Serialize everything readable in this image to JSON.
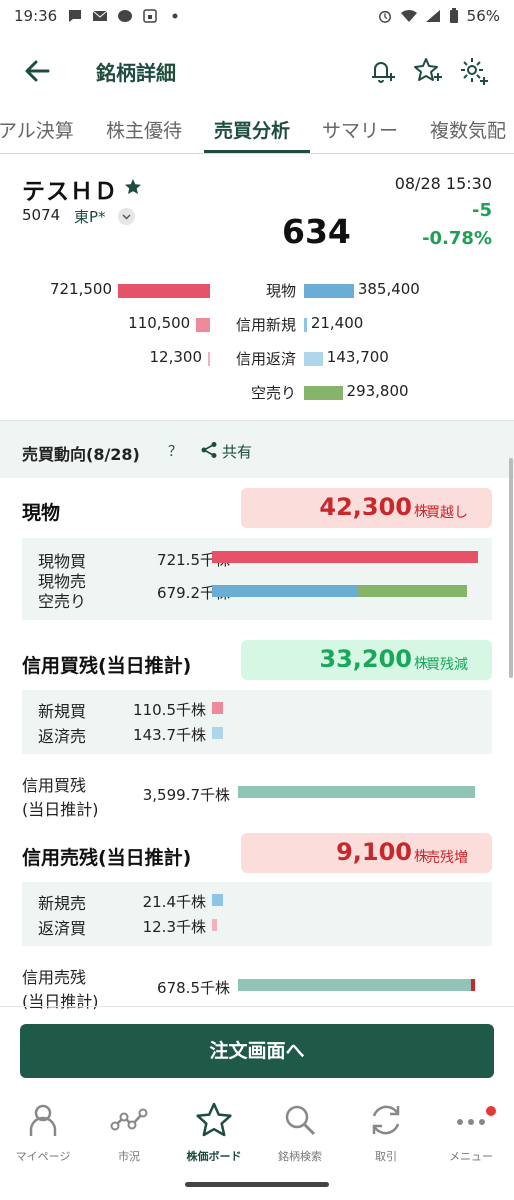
{
  "status_bar": {
    "time": "19:36",
    "battery": "56%"
  },
  "header": {
    "title": "銘柄詳細"
  },
  "tabs": [
    {
      "label": "アル決算"
    },
    {
      "label": "株主優待"
    },
    {
      "label": "売買分析"
    },
    {
      "label": "サマリー"
    },
    {
      "label": "複数気配"
    }
  ],
  "stock": {
    "name": "テスＨＤ",
    "code": "5074",
    "market": "東P*",
    "price": "634",
    "datetime": "08/28 15:30",
    "change": "-5",
    "change_pct": "-0.78%"
  },
  "summary": [
    {
      "left_value": "721,500",
      "left_fraction": 1.0,
      "left_color": "#e5526a",
      "label": "現物",
      "right_value": "385,400",
      "right_fraction": 0.53,
      "right_color": "#6aaed6"
    },
    {
      "left_value": "110,500",
      "left_fraction": 0.15,
      "left_color": "#ee8a9a",
      "label": "信用新規",
      "right_value": "21,400",
      "right_fraction": 0.03,
      "right_color": "#8ec4e6"
    },
    {
      "left_value": "12,300",
      "left_fraction": 0.02,
      "left_color": "#f2b2bd",
      "label": "信用返済",
      "right_value": "143,700",
      "right_fraction": 0.2,
      "right_color": "#aed6ea"
    },
    {
      "left_value": "",
      "left_fraction": 0,
      "left_color": "#ffffff",
      "label": "空売り",
      "right_value": "293,800",
      "right_fraction": 0.41,
      "right_color": "#86b46a"
    }
  ],
  "trend": {
    "title": "売買動向(8/28)",
    "help": "？",
    "share": "共有"
  },
  "sections": {
    "spot": {
      "title": "現物",
      "pill_value": "42,300",
      "pill_unit": "株",
      "pill_note": "買越し",
      "rows": [
        {
          "label": "現物買",
          "value": "721.5千株"
        },
        {
          "label": "現物売\n空売り",
          "value": "679.2千株"
        }
      ],
      "bars": {
        "buy_fraction": 1.0,
        "sell_spot_fraction": 0.55,
        "short_fraction": 0.41
      }
    },
    "margin_buy": {
      "title": "信用買残(当日推計)",
      "pill_value": "33,200",
      "pill_unit": "株",
      "pill_note": "買残減",
      "rows": [
        {
          "label": "新規買",
          "value": "110.5千株",
          "fraction": 0.04
        },
        {
          "label": "返済売",
          "value": "143.7千株",
          "fraction": 0.04
        }
      ],
      "balance": {
        "label_1": "信用買残",
        "label_2": "(当日推計)",
        "value": "3,599.7千株",
        "fraction": 1.0
      }
    },
    "margin_sell": {
      "title": "信用売残(当日推計)",
      "pill_value": "9,100",
      "pill_unit": "株",
      "pill_note": "売残増",
      "rows": [
        {
          "label": "新規売",
          "value": "21.4千株",
          "fraction": 0.04
        },
        {
          "label": "返済買",
          "value": "12.3千株",
          "fraction": 0.02
        }
      ],
      "balance": {
        "label_1": "信用売残",
        "label_2": "(当日推計)",
        "value": "678.5千株",
        "fraction": 1.0
      }
    }
  },
  "order_button": "注文画面へ",
  "nav": [
    {
      "label": "マイページ",
      "icon": "person-icon"
    },
    {
      "label": "市況",
      "icon": "market-chart-icon"
    },
    {
      "label": "株価ボード",
      "icon": "star-icon"
    },
    {
      "label": "銘柄検索",
      "icon": "search-icon"
    },
    {
      "label": "取引",
      "icon": "refresh-icon"
    },
    {
      "label": "メニュー",
      "icon": "more-dots-icon"
    }
  ],
  "colors": {
    "brand": "#1e4d3c",
    "up_red": "#c8282c",
    "down_green": "#18a859",
    "bar_balance": "#8fc4b6"
  }
}
